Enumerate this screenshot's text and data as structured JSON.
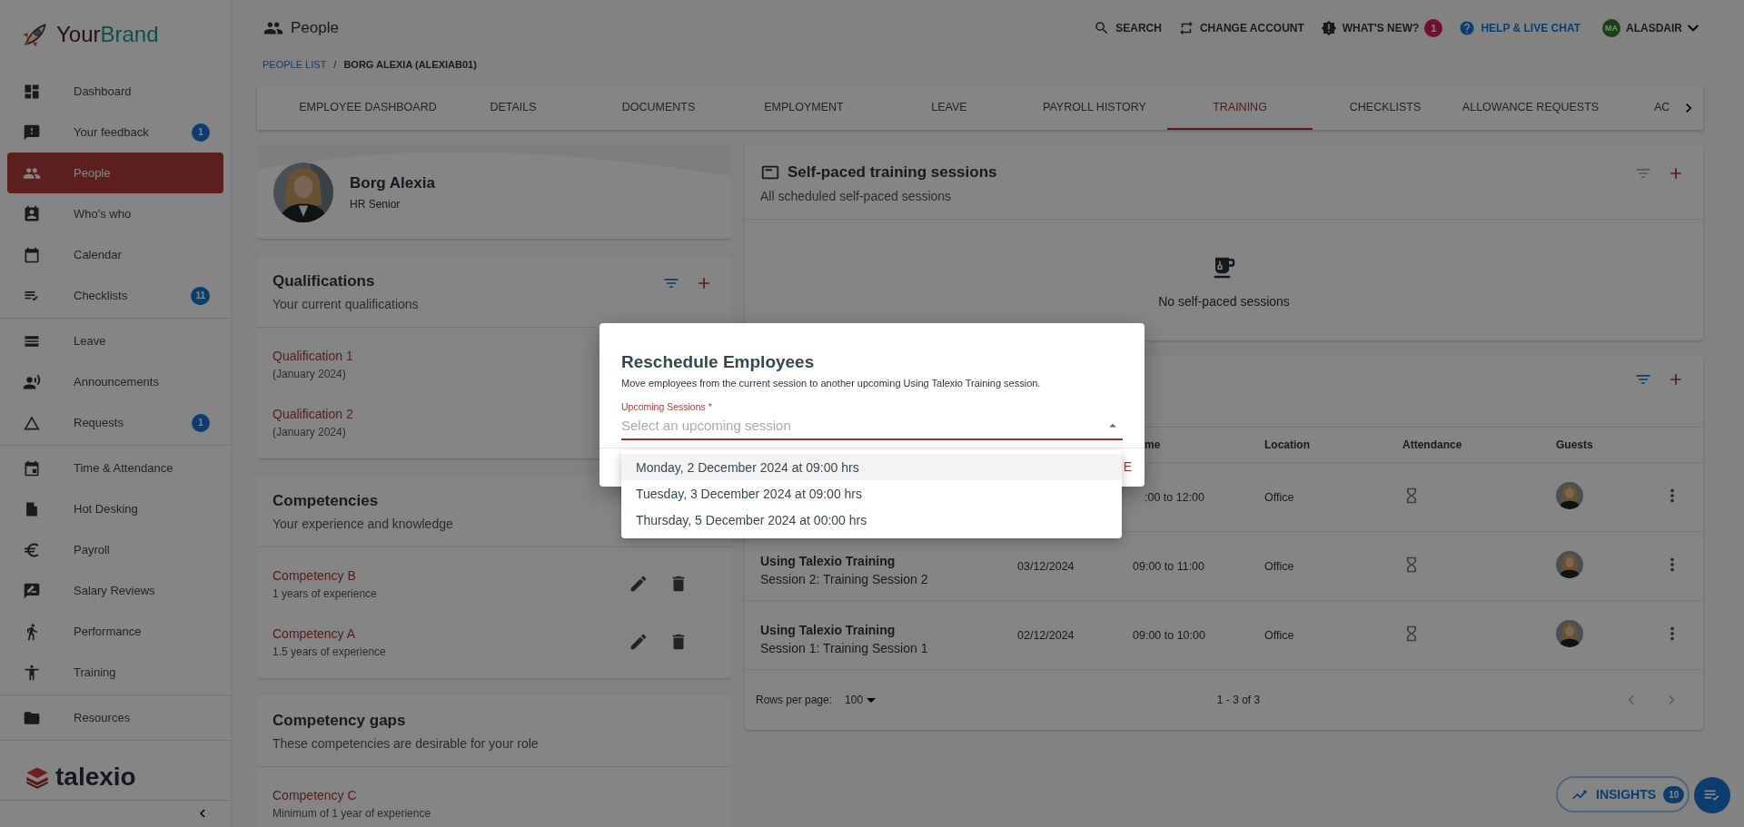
{
  "brand": {
    "parts": [
      "Your",
      "Brand"
    ]
  },
  "sidebar": {
    "groups": [
      [
        {
          "label": "Dashboard",
          "selected": false
        },
        {
          "label": "Your feedback",
          "badge": "1",
          "selected": false
        },
        {
          "label": "People",
          "selected": true
        },
        {
          "label": "Who's who",
          "selected": false
        },
        {
          "label": "Calendar",
          "selected": false
        },
        {
          "label": "Checklists",
          "badge": "11",
          "selected": false
        }
      ],
      [
        {
          "label": "Leave",
          "selected": false
        },
        {
          "label": "Announcements",
          "selected": false
        },
        {
          "label": "Requests",
          "badge": "1",
          "selected": false
        }
      ],
      [
        {
          "label": "Time & Attendance",
          "selected": false
        },
        {
          "label": "Hot Desking",
          "selected": false
        },
        {
          "label": "Payroll",
          "selected": false
        },
        {
          "label": "Salary Reviews",
          "selected": false
        },
        {
          "label": "Performance",
          "selected": false
        },
        {
          "label": "Training",
          "selected": false
        }
      ],
      [
        {
          "label": "Resources",
          "selected": false
        }
      ]
    ],
    "footer_logo": "talexio"
  },
  "header": {
    "title": "People",
    "actions": [
      {
        "label": "SEARCH",
        "highlight": false
      },
      {
        "label": "CHANGE ACCOUNT",
        "highlight": false
      },
      {
        "label": "WHAT'S NEW?",
        "badge": "1",
        "highlight": false
      },
      {
        "label": "HELP & LIVE CHAT",
        "highlight": true
      }
    ],
    "user": {
      "initials": "MA",
      "name": "ALASDAIR"
    }
  },
  "breadcrumb": [
    "PEOPLE LIST",
    "/",
    "BORG ALEXIA (ALEXIAB01)"
  ],
  "tabs": [
    {
      "label": "EMPLOYEE DASHBOARD",
      "selected": false
    },
    {
      "label": "DETAILS",
      "selected": false
    },
    {
      "label": "DOCUMENTS",
      "selected": false
    },
    {
      "label": "EMPLOYMENT",
      "selected": false
    },
    {
      "label": "LEAVE",
      "selected": false
    },
    {
      "label": "PAYROLL HISTORY",
      "selected": false
    },
    {
      "label": "TRAINING",
      "selected": true
    },
    {
      "label": "CHECKLISTS",
      "selected": false
    },
    {
      "label": "ALLOWANCE REQUESTS",
      "selected": false
    },
    {
      "label": "AC",
      "selected": false
    }
  ],
  "profile": {
    "name": "Borg Alexia",
    "role": "HR Senior"
  },
  "qualifications": {
    "title": "Qualifications",
    "subtitle": "Your current qualifications",
    "filter_active": true,
    "items": [
      {
        "name": "Qualification 1",
        "detail": "(January 2024)"
      },
      {
        "name": "Qualification 2",
        "detail": "(January 2024)"
      }
    ]
  },
  "competencies": {
    "title": "Competencies",
    "subtitle": "Your experience and knowledge",
    "items": [
      {
        "name": "Competency B",
        "detail": "1 years of experience"
      },
      {
        "name": "Competency A",
        "detail": "1.5 years of experience"
      }
    ]
  },
  "competency_gaps": {
    "title": "Competency gaps",
    "subtitle": "These competencies are desirable for your role",
    "items": [
      {
        "name": "Competency C",
        "detail": "Minimum of 1 year of experience"
      }
    ]
  },
  "self_paced": {
    "title": "Self-paced training sessions",
    "subtitle": "All scheduled self-paced sessions",
    "filter_active": false,
    "empty": "No self-paced sessions"
  },
  "sessions": {
    "filter_active": true,
    "columns": [
      {
        "label": "me"
      },
      {
        "label": "Location"
      },
      {
        "label": "Attendance"
      },
      {
        "label": "Guests"
      }
    ],
    "rows": [
      {
        "time": ":00 to 12:00",
        "location": "Office"
      },
      {
        "title": "Using Talexio Training",
        "subtitle": "Session 2: Training Session 2",
        "date": "03/12/2024",
        "time": "09:00 to 11:00",
        "location": "Office"
      },
      {
        "title": "Using Talexio Training",
        "subtitle": "Session 1: Training Session 1",
        "date": "02/12/2024",
        "time": "09:00 to 10:00",
        "location": "Office"
      }
    ],
    "rows_per_page_label": "Rows per page:",
    "rows_per_page": "100",
    "range": "1 - 3 of 3"
  },
  "dialog": {
    "title": "Reschedule Employees",
    "text": "Move employees from the current session to another upcoming Using Talexio Training session.",
    "field_label": "Upcoming Sessions *",
    "placeholder": "Select an upcoming session",
    "button": "E",
    "options": [
      {
        "label": "Monday, 2 December 2024 at 09:00 hrs",
        "selected": true
      },
      {
        "label": "Tuesday, 3 December 2024 at 09:00 hrs",
        "selected": false
      },
      {
        "label": "Thursday, 5 December 2024 at 00:00 hrs",
        "selected": false
      }
    ]
  },
  "insights": {
    "label": "INSIGHTS",
    "count": "10"
  }
}
